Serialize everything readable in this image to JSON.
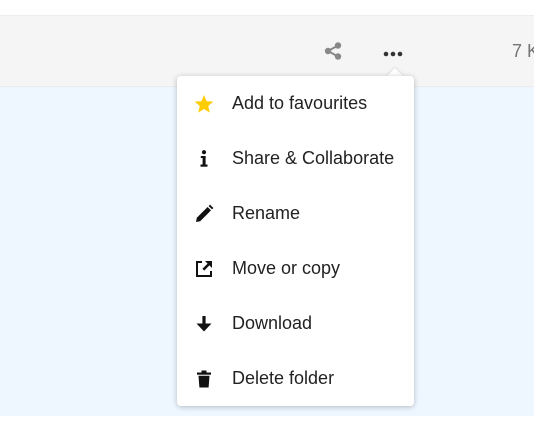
{
  "file_row": {
    "size_text": "7 K",
    "share_icon": "share-icon",
    "more_icon": "more-horizontal-icon"
  },
  "menu": {
    "items": [
      {
        "label": "Add to favourites",
        "icon": "star-icon"
      },
      {
        "label": "Share & Collaborate",
        "icon": "info-icon"
      },
      {
        "label": "Rename",
        "icon": "pencil-icon"
      },
      {
        "label": "Move or copy",
        "icon": "external-link-icon"
      },
      {
        "label": "Download",
        "icon": "download-arrow-icon"
      },
      {
        "label": "Delete folder",
        "icon": "trash-icon"
      }
    ]
  },
  "colors": {
    "star": "#FFCC00",
    "highlight_background": "#EEF7FF",
    "row_background": "#F5F5F5",
    "icon_grey": "#888888"
  }
}
